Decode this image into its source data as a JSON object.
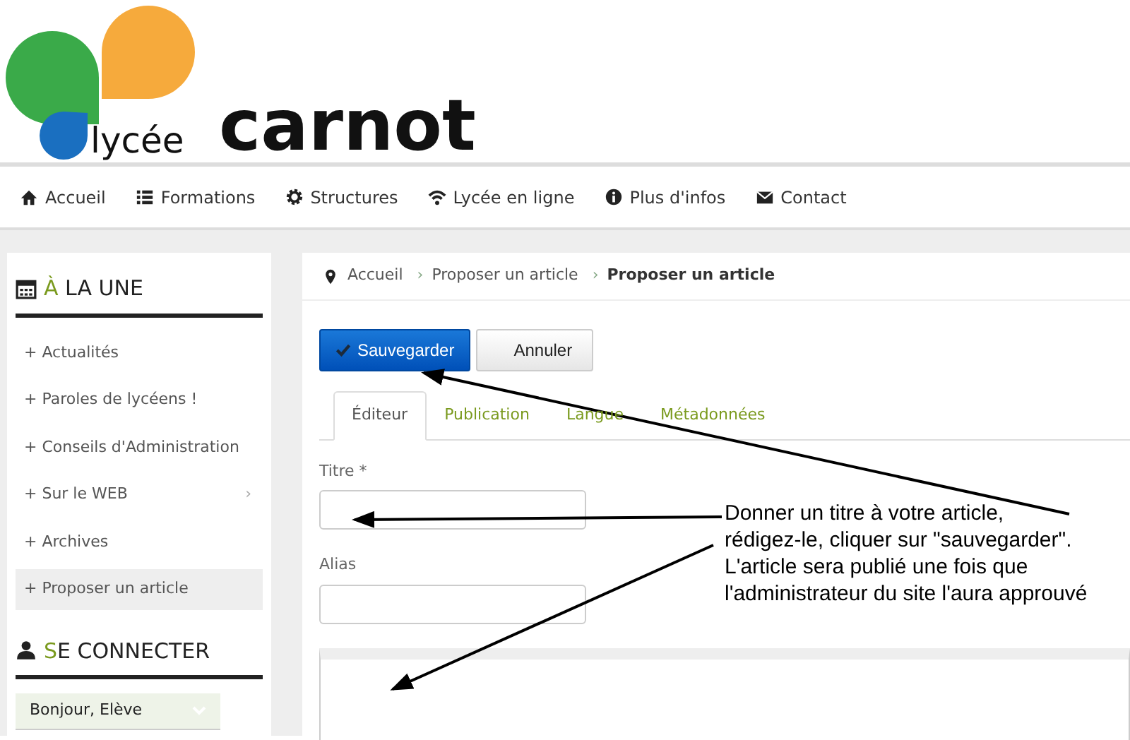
{
  "logo": {
    "small": "lycée",
    "large": "carnot"
  },
  "nav": [
    {
      "label": "Accueil"
    },
    {
      "label": "Formations"
    },
    {
      "label": "Structures"
    },
    {
      "label": "Lycée en ligne"
    },
    {
      "label": "Plus d'infos"
    },
    {
      "label": "Contact"
    }
  ],
  "sidebar": [
    {
      "initial": "À",
      "rest": " LA UNE",
      "items": [
        {
          "label": "+ Actualités",
          "selected": false
        },
        {
          "label": "+ Paroles de lycéens !",
          "selected": false
        },
        {
          "label": "+ Conseils d'Administration",
          "selected": false
        },
        {
          "label": "+ Sur le WEB",
          "selected": false,
          "submenu_marker": "›"
        },
        {
          "label": "+ Archives",
          "selected": false
        },
        {
          "label": "+ Proposer un article",
          "selected": true
        }
      ]
    },
    {
      "initial": "S",
      "rest": "E CONNECTER",
      "dropdown": "Bonjour, Elève"
    }
  ],
  "breadcrumb": [
    {
      "label": "Accueil",
      "current": false
    },
    {
      "separator": "›",
      "label": "Proposer un article",
      "current": false
    },
    {
      "separator": "›",
      "label": "Proposer un article",
      "current": true
    }
  ],
  "buttons": [
    {
      "label": "Sauvegarder",
      "kind": "primary"
    },
    {
      "label": "Annuler",
      "kind": "secondary"
    }
  ],
  "tabs": [
    {
      "label": "Éditeur",
      "selected": true
    },
    {
      "label": "Publication",
      "selected": false
    },
    {
      "label": "Langue",
      "selected": false
    },
    {
      "label": "Métadonnées",
      "selected": false
    }
  ],
  "fields": [
    {
      "label": "Titre *"
    },
    {
      "label": "Alias"
    }
  ],
  "annotation": [
    "Donner un titre à votre article,",
    "rédigez-le, cliquer sur \"sauvegarder\".",
    "L'article sera publié une fois que",
    "l'administrateur du site l'aura approuvé"
  ]
}
